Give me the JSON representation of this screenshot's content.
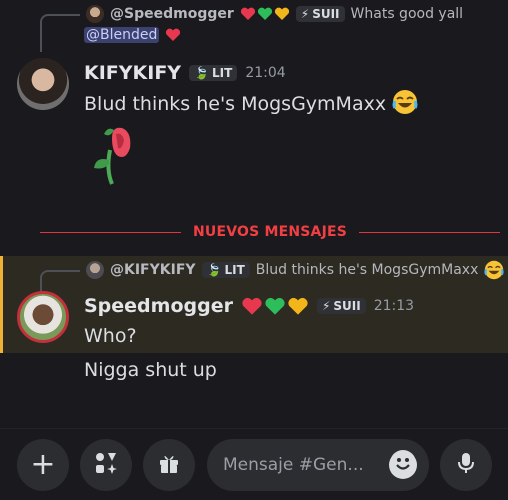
{
  "reply1": {
    "author": "@Speedmogger",
    "tag_icon": "⚡",
    "tag_label": "SUII",
    "text": "Whats good yall",
    "mention": "@Blended"
  },
  "message1": {
    "username": "KIFYKIFY",
    "tag_label": "LIT",
    "timestamp": "21:04",
    "text": "Blud thinks he's MogsGymMaxx",
    "emoji": "joy-emoji"
  },
  "divider": {
    "label": "NUEVOS MENSAJES"
  },
  "reply2": {
    "author": "@KIFYKIFY",
    "tag_label": "LIT",
    "text": "Blud thinks he's MogsGymMaxx"
  },
  "message2": {
    "username": "Speedmogger",
    "tag_icon": "⚡",
    "tag_label": "SUII",
    "timestamp": "21:13",
    "text": "Who?"
  },
  "message3": {
    "text": "Nigga shut up"
  },
  "composer": {
    "placeholder": "Mensaje #Gen...",
    "plus_icon": "plus-icon",
    "apps_icon": "apps-icon",
    "gift_icon": "gift-icon",
    "emoji_icon": "emoji-icon",
    "mic_icon": "mic-icon"
  },
  "colors": {
    "background": "#1a1a1e",
    "new_messages": "#f23f43",
    "highlight_bar": "#f0b232",
    "mention_bg": "#3c4270"
  }
}
